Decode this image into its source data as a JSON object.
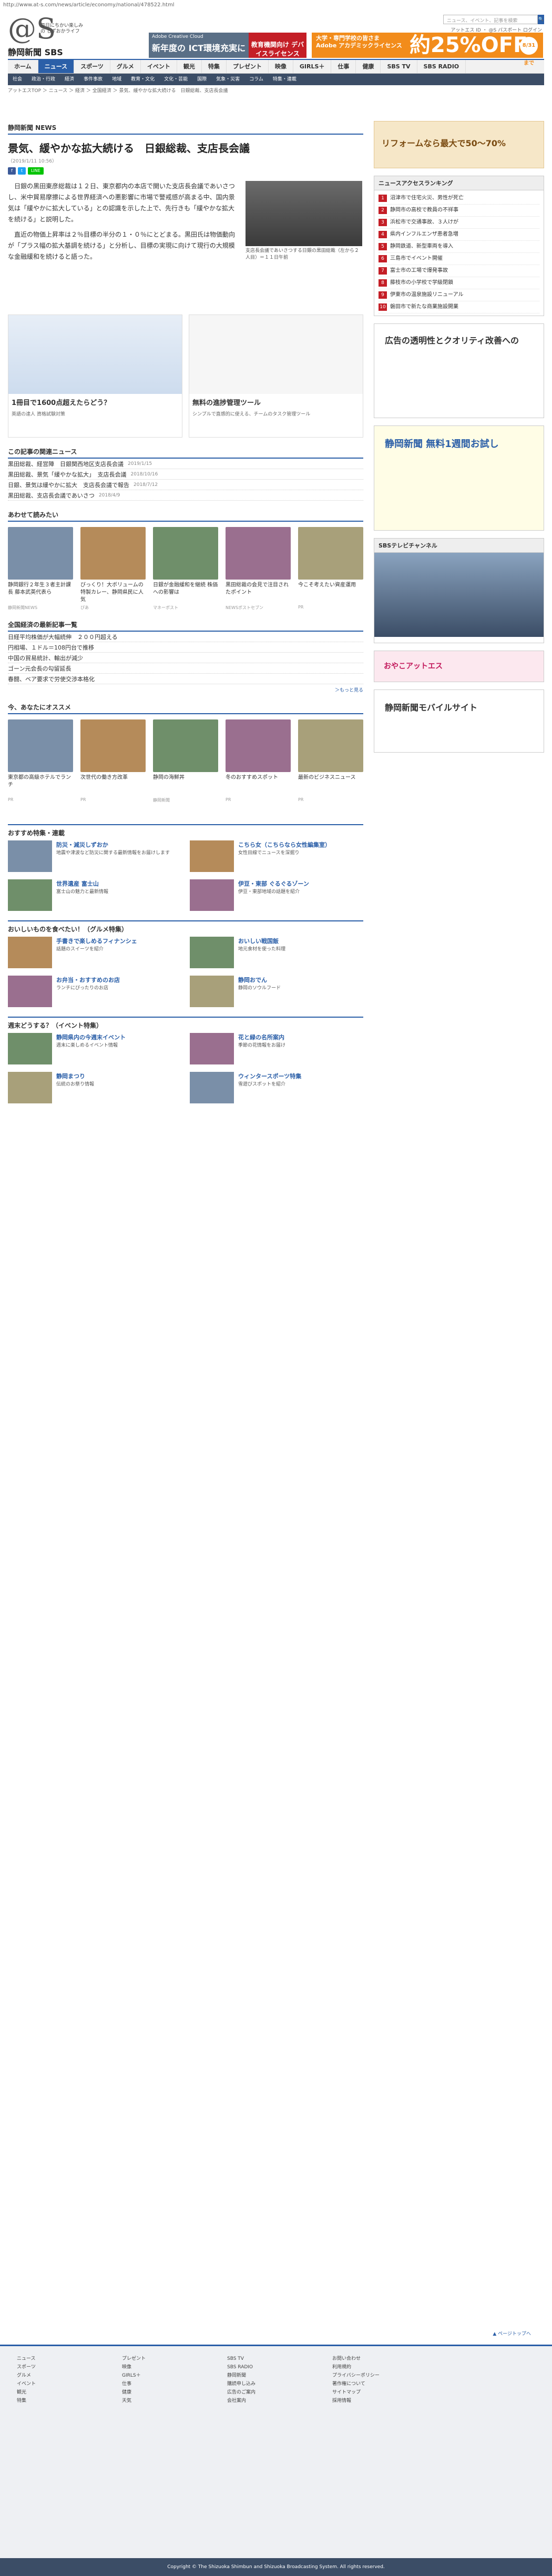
{
  "url": "http://www.at-s.com/news/article/economy/national/478522.html",
  "header": {
    "logo_tagline": "毎日にちかい楽しみの しずおかライフ",
    "logo_name": "静岡新聞 SBS",
    "search_placeholder": "ニュース、イベント、記事を検索",
    "search_button": "検索",
    "links": "アットエス ID ・ @S パスポート ログイン",
    "ad1_line1": "Adobe Creative Cloud",
    "ad1_line2": "新年度の ICT環境充実に",
    "ad1_badge": "教育機関向け デバイスライセンス",
    "ad2_line1": "大学・専門学校の皆さま",
    "ad2_line2": "Adobe アカデミックライセンス",
    "ad2_big": "約25%OFF",
    "ad2_date": "8/31まで"
  },
  "nav": [
    "ホーム",
    "ニュース",
    "スポーツ",
    "グルメ",
    "イベント",
    "観光",
    "特集",
    "プレゼント",
    "映像",
    "GIRLS＋",
    "仕事",
    "健康",
    "SBS TV",
    "SBS RADIO"
  ],
  "subnav": [
    "社会",
    "政治・行政",
    "経済",
    "事件事故",
    "地域",
    "教育・文化",
    "文化・芸能",
    "国際",
    "気象・災害",
    "コラム",
    "特集・連載"
  ],
  "breadcrumb": "アットエスTOP ＞ ニュース ＞ 経済 ＞ 全国経済 ＞ 景気、緩やかな拡大続ける　日銀総裁、支店長会議",
  "section": "静岡新聞 NEWS",
  "article": {
    "title": "景気、緩やかな拡大続ける　日銀総裁、支店長会議",
    "date": "（2019/1/11 10:56）",
    "p1": "　日銀の黒田東彦総裁は１２日、東京都内の本店で開いた支店長会議であいさつし、米中貿易摩擦による世界経済への悪影響に市場で警戒感が高まる中、国内景気は「緩やかに拡大している」との認識を示した上で、先行きも「緩やかな拡大を続ける」と説明した。",
    "p2": "　直近の物価上昇率は２％目標の半分の１・０％にとどまる。黒田氏は物価動向が「プラス幅の拡大基調を続ける」と分析し、目標の実現に向けて現行の大規模な金融緩和を続けると語った。",
    "photo_caption": "支店長会議であいさつする日銀の黒田総裁（左から２人目）＝１１日午前"
  },
  "ad_row": [
    {
      "title": "1冊目で1600点超えたらどう？",
      "sub": "英語の達人 資格試験対策"
    },
    {
      "title": "無料の進捗管理ツール",
      "sub": "シンプルで直感的に使える、チームのタスク管理ツール"
    }
  ],
  "related_title": "この記事の関連ニュース",
  "related": [
    {
      "t": "黒田総裁、経営陣　日銀関西地区支店長会議",
      "d": "2019/1/15"
    },
    {
      "t": "黒田総裁、景気「緩やかな拡大」　支店長会議",
      "d": "2018/10/16"
    },
    {
      "t": "日銀、景気は緩やかに拡大　支店長会議で報告",
      "d": "2018/7/12"
    },
    {
      "t": "黒田総裁、支店長会議であいさつ",
      "d": "2018/4/9"
    }
  ],
  "recommend_title": "あわせて読みたい",
  "recommend": [
    {
      "t": "静岡銀行２年生３者主計課長 藤本武英代表ら",
      "s": "静岡新聞NEWS"
    },
    {
      "t": "びっくり！大ボリュームの特製カレー、静岡県民に人気",
      "s": "ぴあ"
    },
    {
      "t": "日銀が金融緩和を継続 株価への影響は",
      "s": "マネーポスト"
    },
    {
      "t": "黒田総裁の会見で注目されたポイント",
      "s": "NEWSポストセブン"
    },
    {
      "t": "今こそ考えたい資産運用",
      "s": "PR"
    }
  ],
  "national_title": "全国経済の最新記事一覧",
  "national": [
    "日経平均株価が大幅続伸　２００円超える",
    "円相場、１ドル＝108円台で推移",
    "中国の貿易統計、輸出が減少",
    "ゴーン元会長の勾留延長",
    "春闘、ベア要求で労使交渉本格化"
  ],
  "osusume_title": "今、あなたにオススメ",
  "osusume": [
    {
      "t": "東京都の高級ホテルでランチ",
      "s": "PR"
    },
    {
      "t": "次世代の働き方改革",
      "s": "PR"
    },
    {
      "t": "静岡の海鮮丼",
      "s": "静岡新聞"
    },
    {
      "t": "冬のおすすめスポット",
      "s": "PR"
    },
    {
      "t": "最新のビジネスニュース",
      "s": "PR"
    }
  ],
  "categories": [
    {
      "hd": "おすすめ特集・連載",
      "items": [
        {
          "t": "防災・減災しずおか",
          "s": "地震や津波など防災に関する最新情報をお届けします"
        },
        {
          "t": "こちら女（こちらなら女性編集室）",
          "s": "女性目線でニュースを深掘り"
        },
        {
          "t": "世界遺産 富士山",
          "s": "富士山の魅力と最新情報"
        },
        {
          "t": "伊豆・東部 ぐるぐるゾーン",
          "s": "伊豆・東部地域の話題を紹介"
        }
      ]
    },
    {
      "hd": "おいしいものを食べたい！（グルメ特集）",
      "items": [
        {
          "t": "手書きで楽しめるフィナンシェ",
          "s": "話題のスイーツを紹介"
        },
        {
          "t": "おいしい戦国飯",
          "s": "地元食材を使った料理"
        },
        {
          "t": "お弁当・おすすめのお店",
          "s": "ランチにぴったりのお店"
        },
        {
          "t": "静岡おでん",
          "s": "静岡のソウルフード"
        }
      ]
    },
    {
      "hd": "週末どうする？（イベント特集）",
      "items": [
        {
          "t": "静岡県内の今週末イベント",
          "s": "週末に楽しめるイベント情報"
        },
        {
          "t": "花と緑の名所案内",
          "s": "季節の花情報をお届け"
        },
        {
          "t": "静岡まつり",
          "s": "伝統のお祭り情報"
        },
        {
          "t": "ウィンタースポーツ特集",
          "s": "雪遊びスポットを紹介"
        }
      ]
    }
  ],
  "side": {
    "ranking_title": "ニュースアクセスランキング",
    "ranking": [
      "沼津市で住宅火災、男性が死亡",
      "静岡市の高校で教員の不祥事",
      "浜松市で交通事故、３人けが",
      "県内インフルエンザ患者急増",
      "静岡鉄道、新型車両を導入",
      "三島市でイベント開催",
      "富士市の工場で爆発事故",
      "藤枝市の小学校で学級閉鎖",
      "伊東市の温泉施設リニューアル",
      "磐田市で新たな商業施設開業"
    ],
    "ad_reform": "リフォームなら最大で50〜70%",
    "ad_ad": "広告の透明性とクオリティ改善への",
    "ad_news": "静岡新聞 無料1週間お試し",
    "tv_title": "SBSテレビチャンネル",
    "gourmet": "おやこアットエス",
    "mobile": "静岡新聞モバイルサイト"
  },
  "footer": {
    "cols": [
      [
        "ニュース",
        "スポーツ",
        "グルメ",
        "イベント",
        "観光",
        "特集"
      ],
      [
        "プレゼント",
        "映像",
        "GIRLS＋",
        "仕事",
        "健康",
        "天気"
      ],
      [
        "SBS TV",
        "SBS RADIO",
        "静岡新聞",
        "購読申し込み",
        "広告のご案内",
        "会社案内"
      ],
      [
        "お問い合わせ",
        "利用規約",
        "プライバシーポリシー",
        "著作権について",
        "サイトマップ",
        "採用情報"
      ]
    ],
    "copyright": "Copyright © The Shizuoka Shimbun and Shizuoka Broadcasting System. All rights reserved.",
    "pagetop": "▲ ページトップへ"
  },
  "colors": {
    "brand": "#2b5fa8",
    "accent": "#c41e26"
  }
}
